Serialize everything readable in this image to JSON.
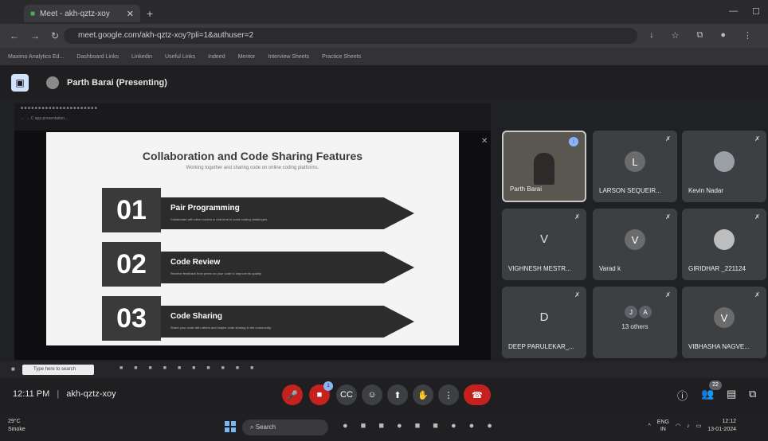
{
  "browser": {
    "tab_title": "Meet - akh-qztz-xoy",
    "url": "meet.google.com/akh-qztz-xoy?pli=1&authuser=2",
    "bookmarks": [
      "Maximo Analytics Ed...",
      "Dashboard Links",
      "Linkedin",
      "Useful Links",
      "Indeed",
      "Mentor",
      "Interview Sheets",
      "Practice Sheets"
    ]
  },
  "meet": {
    "presenter_label": "Parth Barai (Presenting)",
    "slide": {
      "title": "Collaboration and Code Sharing Features",
      "subtitle": "Working together and sharing code on online coding platforms.",
      "features": [
        {
          "num": "01",
          "title": "Pair Programming",
          "desc": "Collaborate with other coders in real-time to solve coding challenges."
        },
        {
          "num": "02",
          "title": "Code Review",
          "desc": "Receive feedback from peers on your code to improve its quality."
        },
        {
          "num": "03",
          "title": "Code Sharing",
          "desc": "Share your code with others and inspire code sharing in the community."
        }
      ]
    },
    "participants": [
      {
        "name": "Parth Barai",
        "type": "video"
      },
      {
        "name": "LARSON SEQUEIR...",
        "letter": "L",
        "type": "avatar"
      },
      {
        "name": "Kevin Nadar",
        "type": "photo"
      },
      {
        "name": "VIGHNESH MESTR...",
        "letter": "V",
        "type": "letter"
      },
      {
        "name": "Varad k",
        "letter": "V",
        "type": "avatar"
      },
      {
        "name": "GIRIDHAR _221124",
        "type": "photo"
      },
      {
        "name": "DEEP PARULEKAR_...",
        "letter": "D",
        "type": "letter"
      },
      {
        "name": "13 others",
        "initials": [
          "J",
          "A"
        ],
        "type": "others"
      },
      {
        "name": "VIBHASHA NAGVE...",
        "letter": "V",
        "type": "avatar"
      }
    ],
    "inner_search_placeholder": "Type here to search",
    "time": "12:11 PM",
    "meeting_code": "akh-qztz-xoy",
    "participant_count": "22"
  },
  "taskbar": {
    "temperature": "29°C",
    "weather": "Smoke",
    "search": "Search",
    "lang_top": "ENG",
    "lang_bottom": "IN",
    "clock_time": "12:12",
    "clock_date": "13-01-2024"
  }
}
